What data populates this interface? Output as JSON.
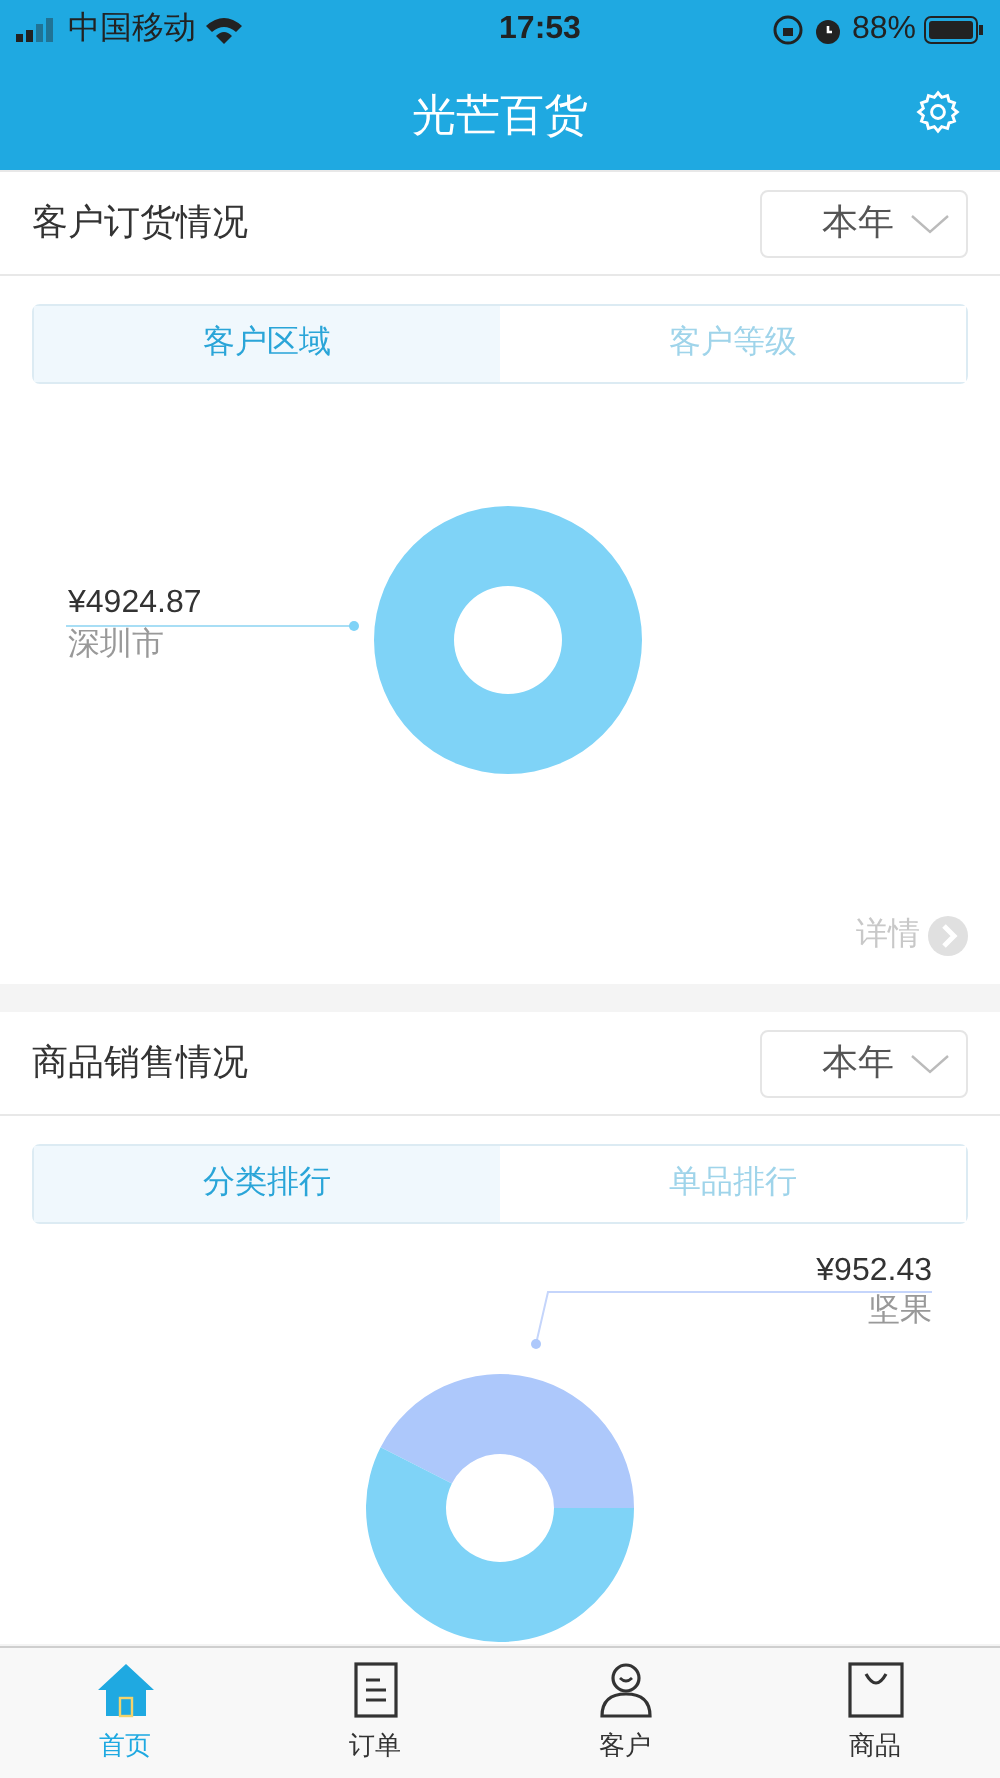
{
  "status_bar": {
    "carrier": "中国移动",
    "time": "17:53",
    "battery": "88%"
  },
  "header": {
    "title": "光芒百货"
  },
  "sections": [
    {
      "title": "客户订货情况",
      "period": "本年",
      "tabs": [
        {
          "label": "客户区域",
          "selected": true
        },
        {
          "label": "客户等级",
          "selected": false
        }
      ],
      "chart": {
        "kind": "left-label",
        "value": "¥4924.87",
        "name": "深圳市",
        "slices": [
          {
            "color": "#7fd3f7"
          }
        ]
      },
      "details": "详情"
    },
    {
      "title": "商品销售情况",
      "period": "本年",
      "tabs": [
        {
          "label": "分类排行",
          "selected": true
        },
        {
          "label": "单品排行",
          "selected": false
        }
      ],
      "chart": {
        "kind": "right-label",
        "value": "¥952.43",
        "name": "坚果",
        "slices": [
          {
            "color": "#adc8fb"
          },
          {
            "color": "#7fd3f7"
          }
        ]
      }
    }
  ],
  "tab_bar": [
    {
      "label": "首页",
      "kind": "home",
      "selected": true
    },
    {
      "label": "订单",
      "kind": "orders",
      "selected": false
    },
    {
      "label": "客户",
      "kind": "customers",
      "selected": false
    },
    {
      "label": "商品",
      "kind": "products",
      "selected": false
    }
  ]
}
